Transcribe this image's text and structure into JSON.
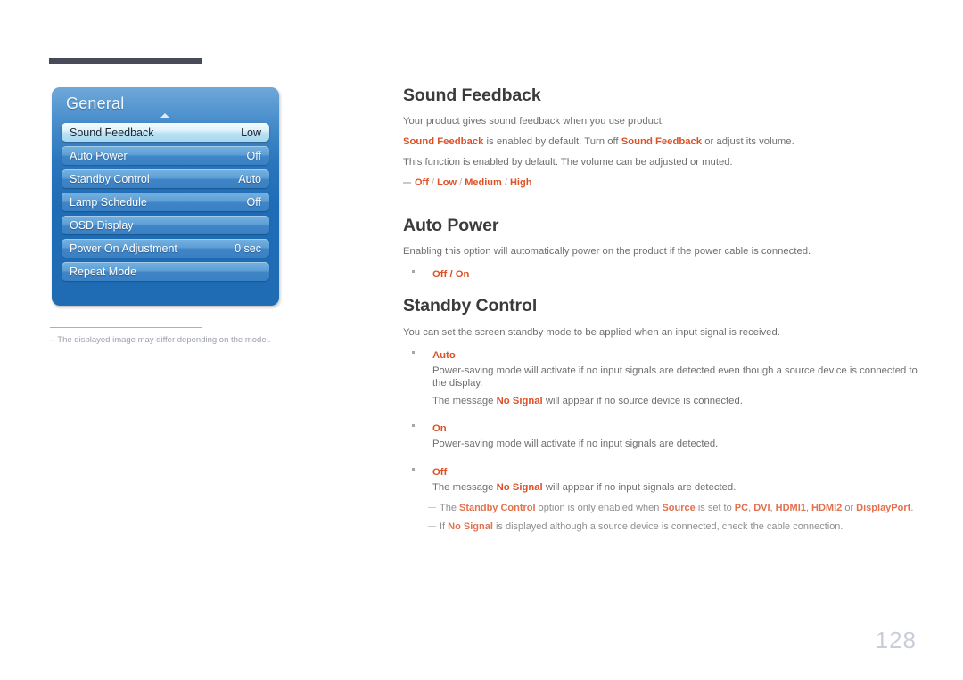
{
  "page": {
    "number": "128"
  },
  "header": {
    "rule_accent_color": "#474a58",
    "rule_line_color": "#8c8c8c"
  },
  "osd": {
    "title": "General",
    "scroll_indicator": "chevron-up-icon",
    "panel_color": "#1f6cb4",
    "rows": [
      {
        "label": "Sound Feedback",
        "value": "Low",
        "selected": true
      },
      {
        "label": "Auto Power",
        "value": "Off",
        "selected": false
      },
      {
        "label": "Standby Control",
        "value": "Auto",
        "selected": false
      },
      {
        "label": "Lamp Schedule",
        "value": "Off",
        "selected": false
      },
      {
        "label": "OSD Display",
        "value": "",
        "selected": false
      },
      {
        "label": "Power On Adjustment",
        "value": "0 sec",
        "selected": false
      },
      {
        "label": "Repeat Mode",
        "value": "",
        "selected": false
      }
    ],
    "footnote": {
      "dash": "–",
      "text": "The displayed image may differ depending on the model."
    }
  },
  "accent_color": "#dd5127",
  "sections": {
    "sound_feedback": {
      "title": "Sound Feedback",
      "p1": "Your product gives sound feedback when you use product.",
      "p2_a": "Sound Feedback",
      "p2_b": " is enabled by default. Turn off ",
      "p2_c": "Sound Feedback",
      "p2_d": " or adjust its volume.",
      "p3": "This function is enabled by default. The volume can be adjusted or muted.",
      "note_options": {
        "off": "Off",
        "sep1": " / ",
        "low": "Low",
        "sep2": " / ",
        "medium": "Medium",
        "sep3": " / ",
        "high": "High"
      }
    },
    "auto_power": {
      "title": "Auto Power",
      "p1": "Enabling this option will automatically power on the product if the power cable is connected.",
      "bullet_options": "Off / On"
    },
    "standby_control": {
      "title": "Standby Control",
      "p1": "You can set the screen standby mode to be applied when an input signal is received.",
      "items": [
        {
          "term": "Auto",
          "detail1": "Power-saving mode will activate if no input signals are detected even though a source device is connected to the display.",
          "detail2_a": "The message ",
          "detail2_hl": "No Signal",
          "detail2_b": " will appear if no source device is connected."
        },
        {
          "term": "On",
          "detail1": "Power-saving mode will activate if no input signals are detected.",
          "detail2_a": "",
          "detail2_hl": "",
          "detail2_b": ""
        },
        {
          "term": "Off",
          "detail1": "",
          "detail2_a": "The message ",
          "detail2_hl": "No Signal",
          "detail2_b": " will appear if no input signals are detected."
        }
      ],
      "note1": {
        "a": "The ",
        "hl1": "Standby Control",
        "b": " option is only enabled when ",
        "hl2": "Source",
        "c": " is set to ",
        "hl3": "PC",
        "d": ", ",
        "hl4": "DVI",
        "e": ", ",
        "hl5": "HDMI1",
        "f": ", ",
        "hl6": "HDMI2",
        "g": " or ",
        "hl7": "DisplayPort",
        "h": "."
      },
      "note2": {
        "a": "If ",
        "hl1": "No Signal",
        "b": " is displayed although a source device is connected, check the cable connection."
      }
    }
  }
}
